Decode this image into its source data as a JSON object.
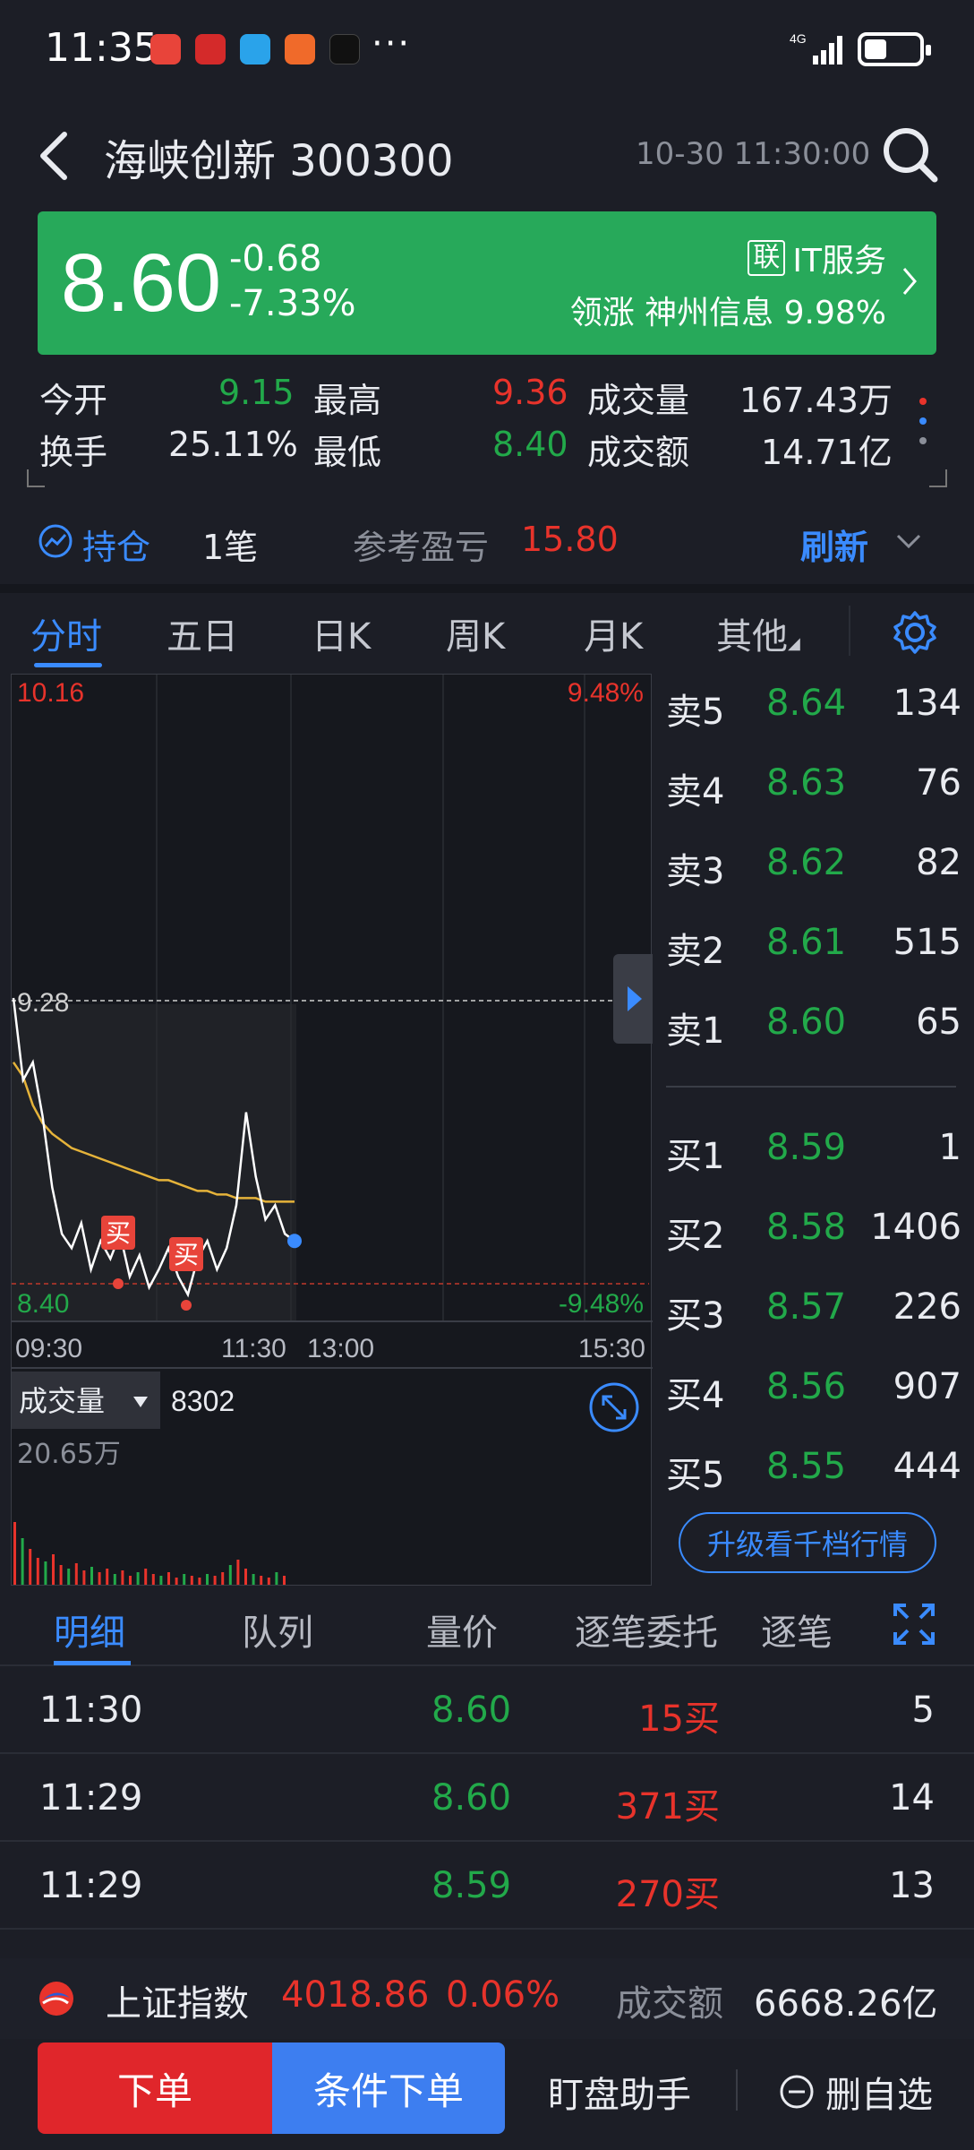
{
  "status_bar": {
    "time": "11:35",
    "network": "4G"
  },
  "header": {
    "title": "海峡创新 300300",
    "datetime": "10-30 11:30:00"
  },
  "banner": {
    "price": "8.60",
    "change": "-0.68",
    "change_pct": "-7.33%",
    "industry_badge": "联",
    "industry": "IT服务",
    "leader_label": "领涨",
    "leader_name": "神州信息",
    "leader_pct": "9.98%",
    "bg_color": "#27a95a"
  },
  "stats": {
    "open_label": "今开",
    "open": "9.15",
    "high_label": "最高",
    "high": "9.36",
    "volume_label": "成交量",
    "volume": "167.43万",
    "turnover_label": "换手",
    "turnover": "25.11%",
    "low_label": "最低",
    "low": "8.40",
    "amount_label": "成交额",
    "amount": "14.71亿"
  },
  "holdings": {
    "label": "持仓",
    "count": "1笔",
    "pnl_label": "参考盈亏",
    "pnl": "15.80",
    "refresh": "刷新"
  },
  "chart_tabs": [
    "分时",
    "五日",
    "日K",
    "周K",
    "月K",
    "其他"
  ],
  "chart": {
    "top_price": "10.16",
    "top_pct": "9.48%",
    "ref_price": "9.28",
    "bottom_price": "8.40",
    "bottom_pct": "-9.48%",
    "x_ticks": [
      "09:30",
      "11:30",
      "13:00",
      "15:30"
    ],
    "buy_marker": "买",
    "volume_label": "成交量",
    "volume_value": "8302",
    "volume_max": "20.65万"
  },
  "chart_data": {
    "type": "line",
    "title": "",
    "x": [
      "09:30",
      "11:30",
      "13:00",
      "15:30"
    ],
    "ylim": [
      8.4,
      10.16
    ],
    "ref_close": 9.28,
    "series": [
      {
        "values": [
          9.28,
          9.05,
          9.1,
          8.95,
          8.75,
          8.62,
          8.58,
          8.65,
          8.52,
          8.6,
          8.55,
          8.62,
          8.5,
          8.56,
          8.47,
          8.52,
          8.58,
          8.5,
          8.45,
          8.55,
          8.6,
          8.52,
          8.58,
          8.7,
          8.96,
          8.78,
          8.66,
          8.7,
          8.62,
          8.6
        ]
      },
      {
        "values": [
          9.1,
          9.06,
          8.98,
          8.93,
          8.9,
          8.88,
          8.86,
          8.85,
          8.84,
          8.83,
          8.82,
          8.81,
          8.8,
          8.79,
          8.78,
          8.77,
          8.77,
          8.76,
          8.75,
          8.74,
          8.74,
          8.73,
          8.73,
          8.72,
          8.72,
          8.72,
          8.71,
          8.71,
          8.71,
          8.71
        ]
      }
    ]
  },
  "orderbook": {
    "asks": [
      {
        "label": "卖5",
        "price": "8.64",
        "vol": "134"
      },
      {
        "label": "卖4",
        "price": "8.63",
        "vol": "76"
      },
      {
        "label": "卖3",
        "price": "8.62",
        "vol": "82"
      },
      {
        "label": "卖2",
        "price": "8.61",
        "vol": "515"
      },
      {
        "label": "卖1",
        "price": "8.60",
        "vol": "65"
      }
    ],
    "bids": [
      {
        "label": "买1",
        "price": "8.59",
        "vol": "1"
      },
      {
        "label": "买2",
        "price": "8.58",
        "vol": "1406"
      },
      {
        "label": "买3",
        "price": "8.57",
        "vol": "226"
      },
      {
        "label": "买4",
        "price": "8.56",
        "vol": "907"
      },
      {
        "label": "买5",
        "price": "8.55",
        "vol": "444"
      }
    ],
    "upgrade": "升级看千档行情"
  },
  "detail_tabs": [
    "明细",
    "队列",
    "量价",
    "逐笔委托",
    "逐笔"
  ],
  "trades": [
    {
      "time": "11:30",
      "price": "8.60",
      "vol": "15买",
      "count": "5"
    },
    {
      "time": "11:29",
      "price": "8.60",
      "vol": "371买",
      "count": "14"
    },
    {
      "time": "11:29",
      "price": "8.59",
      "vol": "270买",
      "count": "13"
    }
  ],
  "index_bar": {
    "name": "上证指数",
    "value": "4018.86",
    "pct": "0.06%",
    "amount_label": "成交额",
    "amount": "6668.26亿"
  },
  "bottom": {
    "order": "下单",
    "conditional": "条件下单",
    "assistant": "盯盘助手",
    "remove_watch": "删自选"
  }
}
